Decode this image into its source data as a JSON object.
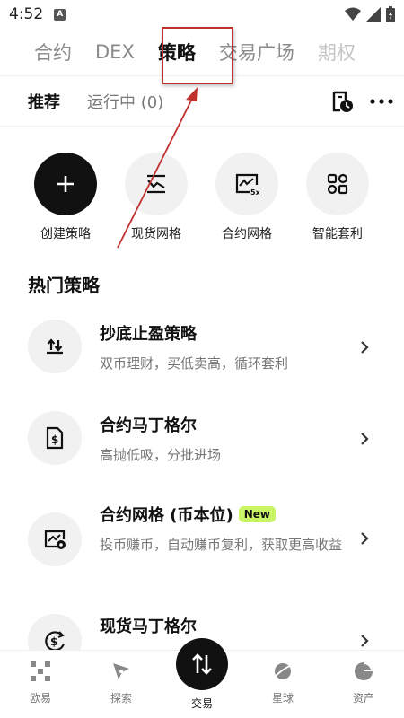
{
  "status": {
    "time": "4:52",
    "app_indicator": "A"
  },
  "top_tabs": [
    {
      "label": "合约"
    },
    {
      "label": "DEX"
    },
    {
      "label": "策略"
    },
    {
      "label": "交易广场"
    },
    {
      "label": "期权"
    }
  ],
  "sub_tabs": {
    "recommended": "推荐",
    "running": "运行中 (0)"
  },
  "quick_actions": [
    {
      "label": "创建策略",
      "icon": "plus-icon"
    },
    {
      "label": "现货网格",
      "icon": "spot-grid-icon"
    },
    {
      "label": "合约网格",
      "icon": "futures-grid-5x-icon",
      "icon_text": "5x"
    },
    {
      "label": "智能套利",
      "icon": "smart-arbitrage-icon"
    }
  ],
  "section_title": "热门策略",
  "strategies": [
    {
      "title": "抄底止盈策略",
      "desc": "双币理财，买低卖高，循环套利",
      "icon": "dip-buy-icon"
    },
    {
      "title": "合约马丁格尔",
      "desc": "高抛低吸，分批进场",
      "icon": "dollar-doc-icon"
    },
    {
      "title": "合约网格 (币本位)",
      "badge": "New",
      "desc": "投币赚币，自动赚币复利，获取更高收益",
      "icon": "coin-grid-icon"
    },
    {
      "title": "现货马丁格尔",
      "desc": "",
      "icon": "dollar-cycle-icon"
    }
  ],
  "bottom_nav": [
    {
      "label": "欧易",
      "icon": "okx-logo-icon"
    },
    {
      "label": "探索",
      "icon": "compass-icon"
    },
    {
      "label": "交易",
      "icon": "trade-swap-icon"
    },
    {
      "label": "星球",
      "icon": "planet-icon"
    },
    {
      "label": "资产",
      "icon": "pie-chart-icon"
    }
  ],
  "colors": {
    "accent_dark": "#111111",
    "badge_green": "#c9f464",
    "annotation_red": "#c0312e"
  }
}
